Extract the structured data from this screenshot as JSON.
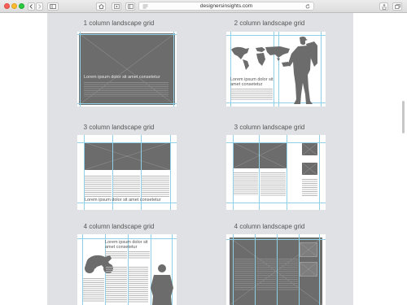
{
  "browser": {
    "url": "designersinsights.com"
  },
  "grids": {
    "titles": [
      "1 column landscape grid",
      "2 column landscape grid",
      "3 column landscape grid",
      "3 column landscape grid",
      "4 column landscape grid",
      "4 column landscape grid"
    ],
    "lorem_single": "Lorem ipsum dolor sit amet consetetur",
    "lorem_line1": "Lorem ipsum dolor sit",
    "lorem_line2": "amet consetetur",
    "lorem_4a_line1": "Lorem ipsum dolor sit",
    "lorem_4a_line2": "amet consetetur"
  },
  "colors": {
    "page_bg": "#dfe1e4",
    "grid_line": "#8fd0e6",
    "placeholder": "#6c6c6c"
  }
}
